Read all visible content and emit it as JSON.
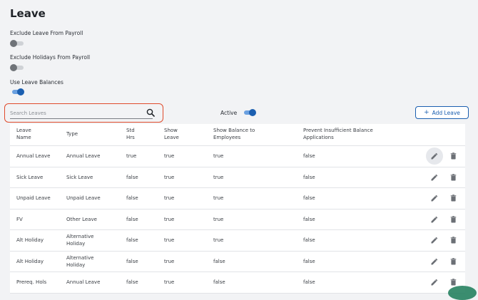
{
  "page": {
    "title": "Leave"
  },
  "settings": [
    {
      "label": "Exclude Leave From Payroll",
      "on": false
    },
    {
      "label": "Exclude Holidays From Payroll",
      "on": false
    },
    {
      "label": "Use Leave Balances",
      "on": true
    }
  ],
  "search": {
    "placeholder": "Search Leaves"
  },
  "filter": {
    "active_label": "Active",
    "active_on": true
  },
  "actions": {
    "add_label": "Add Leave"
  },
  "table": {
    "headers": {
      "name": [
        "Leave",
        "Name"
      ],
      "type": [
        "Type"
      ],
      "std_hrs": [
        "Std",
        "Hrs"
      ],
      "show_leave": [
        "Show",
        "Leave"
      ],
      "show_balance": [
        "Show Balance to",
        "Employees"
      ],
      "prevent": [
        "Prevent Insufficient Balance",
        "Applications"
      ]
    },
    "rows": [
      {
        "name": "Annual Leave",
        "type": [
          "Annual Leave"
        ],
        "std_hrs": "true",
        "show_leave": "true",
        "show_balance": "true",
        "prevent": "false"
      },
      {
        "name": "Sick Leave",
        "type": [
          "Sick Leave"
        ],
        "std_hrs": "false",
        "show_leave": "true",
        "show_balance": "true",
        "prevent": "false"
      },
      {
        "name": "Unpaid Leave",
        "type": [
          "Unpaid Leave"
        ],
        "std_hrs": "false",
        "show_leave": "true",
        "show_balance": "true",
        "prevent": "false"
      },
      {
        "name": "FV",
        "type": [
          "Other Leave"
        ],
        "std_hrs": "false",
        "show_leave": "true",
        "show_balance": "true",
        "prevent": "false"
      },
      {
        "name": "Alt Holiday",
        "type": [
          "Alternative",
          "Holiday"
        ],
        "std_hrs": "false",
        "show_leave": "true",
        "show_balance": "true",
        "prevent": "false"
      },
      {
        "name": "Alt Holiday",
        "type": [
          "Alternative",
          "Holiday"
        ],
        "std_hrs": "false",
        "show_leave": "true",
        "show_balance": "false",
        "prevent": "false"
      },
      {
        "name": "Prereq. Hols",
        "type": [
          "Annual Leave"
        ],
        "std_hrs": "false",
        "show_leave": "true",
        "show_balance": "false",
        "prevent": "false"
      }
    ]
  },
  "icons": {
    "edit": "pencil-icon",
    "delete": "trash-icon",
    "search": "search-icon",
    "add": "plus-icon"
  },
  "colors": {
    "accent": "#1b5fb0",
    "highlight": "#e04b2c",
    "toggle_off": "#6f7378"
  }
}
